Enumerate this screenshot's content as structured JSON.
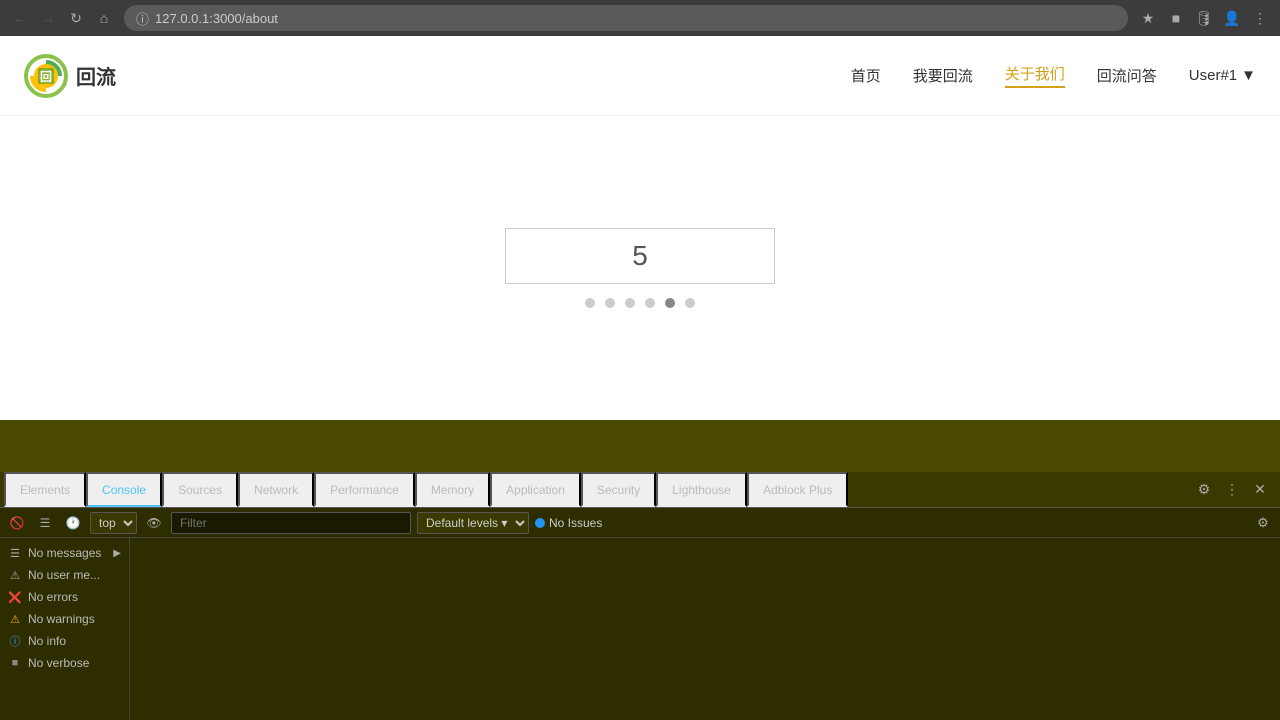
{
  "browser": {
    "url": "127.0.0.1:3000/about",
    "back_disabled": true,
    "forward_disabled": true
  },
  "site": {
    "title": "回流",
    "nav": {
      "links": [
        {
          "label": "首页",
          "active": false
        },
        {
          "label": "我要回流",
          "active": false
        },
        {
          "label": "关于我们",
          "active": true
        },
        {
          "label": "回流问答",
          "active": false
        }
      ],
      "user": "User#1"
    },
    "main": {
      "number": "5",
      "dots": [
        false,
        false,
        false,
        false,
        true,
        false
      ]
    }
  },
  "devtools": {
    "tabs": [
      {
        "label": "Elements",
        "active": false
      },
      {
        "label": "Console",
        "active": true
      },
      {
        "label": "Sources",
        "active": false
      },
      {
        "label": "Network",
        "active": false
      },
      {
        "label": "Performance",
        "active": false
      },
      {
        "label": "Memory",
        "active": false
      },
      {
        "label": "Application",
        "active": false
      },
      {
        "label": "Security",
        "active": false
      },
      {
        "label": "Lighthouse",
        "active": false
      },
      {
        "label": "Adblock Plus",
        "active": false
      }
    ],
    "toolbar": {
      "context": "top",
      "filter_placeholder": "Filter",
      "levels_label": "Default levels",
      "no_issues_label": "No Issues"
    },
    "sidebar": {
      "items": [
        {
          "label": "No messages",
          "icon": "list",
          "has_arrow": true
        },
        {
          "label": "No user me...",
          "icon": "circle-slash"
        },
        {
          "label": "No errors",
          "icon": "red-x"
        },
        {
          "label": "No warnings",
          "icon": "warning"
        },
        {
          "label": "No info",
          "icon": "info"
        },
        {
          "label": "No verbose",
          "icon": "verbose"
        }
      ]
    }
  }
}
